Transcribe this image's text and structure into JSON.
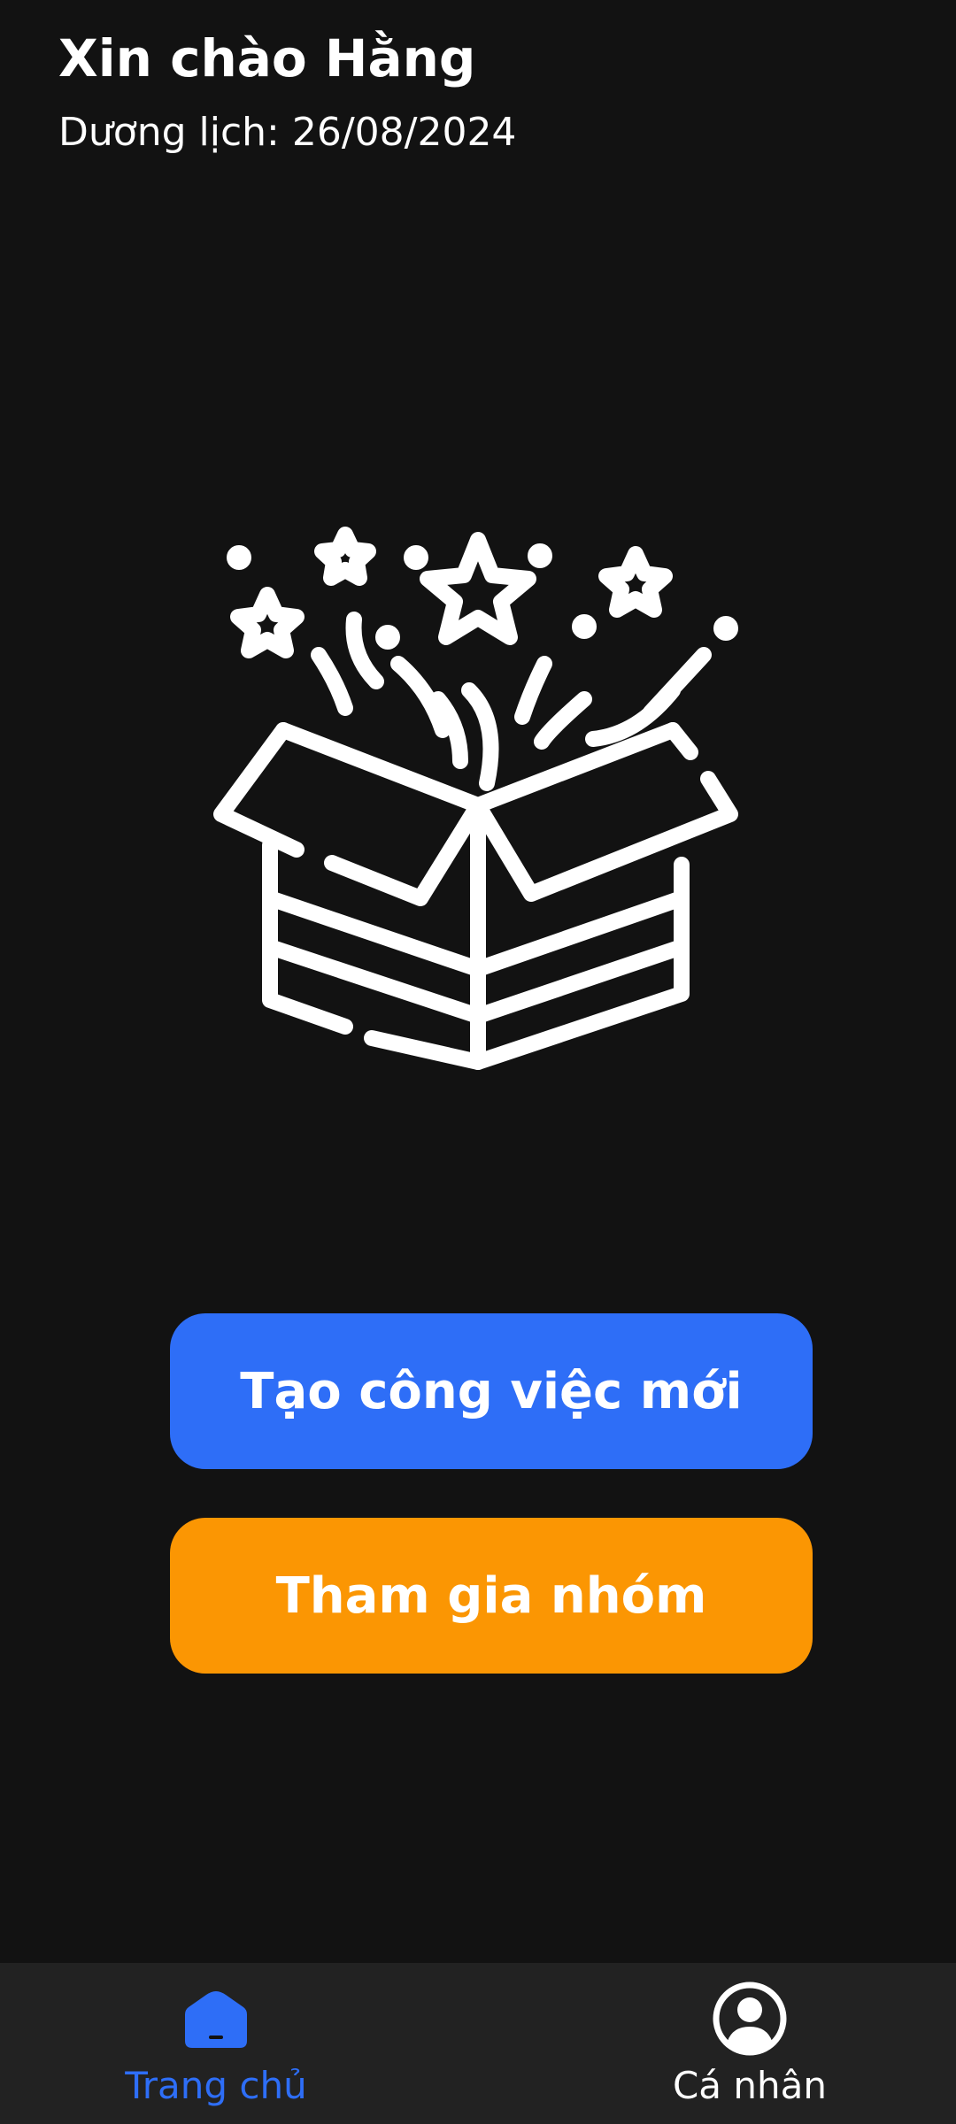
{
  "header": {
    "greeting": "Xin chào Hằng",
    "date": "Dương lịch: 26/08/2024"
  },
  "illustration": {
    "icon": "gift-box-stars-icon"
  },
  "actions": {
    "create_task_label": "Tạo công việc mới",
    "join_group_label": "Tham gia nhóm"
  },
  "bottom_nav": {
    "items": [
      {
        "label": "Trang chủ",
        "icon": "home-icon",
        "active": true
      },
      {
        "label": "Cá nhân",
        "icon": "user-circle-icon",
        "active": false
      }
    ]
  },
  "colors": {
    "background": "#121212",
    "nav_background": "#222222",
    "primary": "#2e6ef7",
    "accent": "#fb9603",
    "text": "#ffffff"
  }
}
